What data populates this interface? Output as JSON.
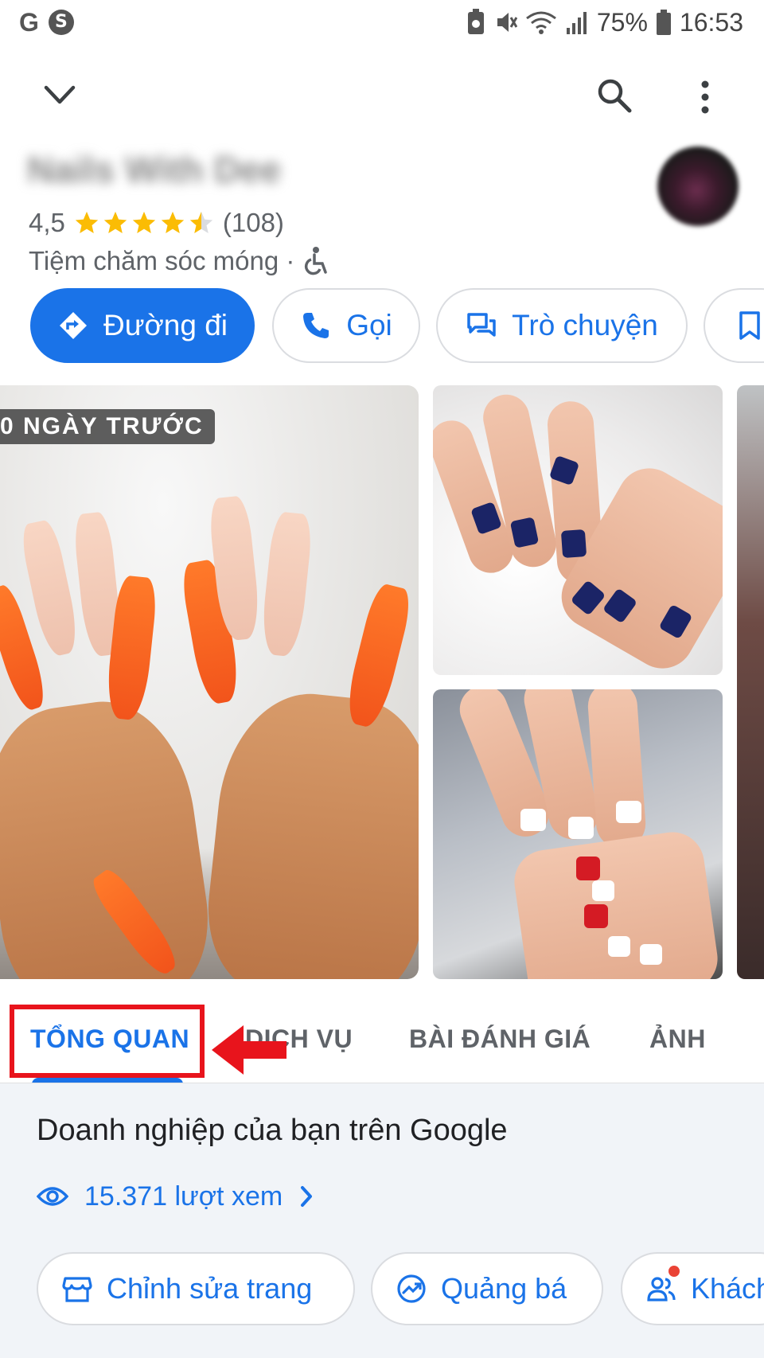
{
  "status_bar": {
    "left_icons": [
      "G",
      "S"
    ],
    "battery": "75%",
    "time": "16:53"
  },
  "business": {
    "name": "Nails With Dee",
    "rating": "4,5",
    "rating_value": 4.5,
    "review_count": "(108)",
    "category": "Tiệm chăm sóc móng ·"
  },
  "actions": {
    "directions": "Đường đi",
    "call": "Gọi",
    "chat": "Trò chuyện"
  },
  "photos": {
    "badge": "0 NGÀY TRƯỚC"
  },
  "tabs": [
    {
      "label": "TỔNG QUAN",
      "active": true
    },
    {
      "label": "DỊCH VỤ",
      "active": false
    },
    {
      "label": "BÀI ĐÁNH GIÁ",
      "active": false
    },
    {
      "label": "ẢNH",
      "active": false
    }
  ],
  "business_card": {
    "title": "Doanh nghiệp của bạn trên Google",
    "views": "15.371 lượt xem",
    "edit_label": "Chỉnh sửa trang",
    "promote_label": "Quảng bá",
    "customers_label": "Khách"
  },
  "colors": {
    "accent": "#1a73e8",
    "star": "#fbbc04",
    "highlight": "#e8141c"
  }
}
